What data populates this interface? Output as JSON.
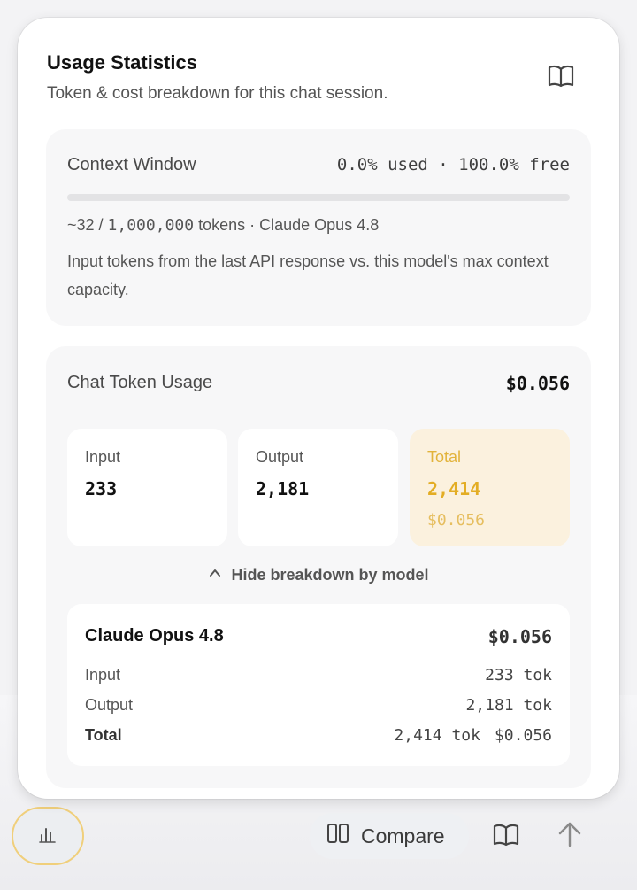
{
  "panel": {
    "title": "Usage Statistics",
    "subtitle": "Token & cost breakdown for this chat session.",
    "docs_icon": "book-icon"
  },
  "context_window": {
    "label": "Context Window",
    "stats": "0.0% used · 100.0% free",
    "used_fraction": 0.0,
    "tokens_prefix": "~32 / ",
    "tokens_max": "1,000,000",
    "tokens_suffix": " tokens · Claude Opus 4.8",
    "description": "Input tokens from the last API response vs. this model's max context capacity."
  },
  "chat_usage": {
    "label": "Chat Token Usage",
    "total_cost": "$0.056",
    "input": {
      "label": "Input",
      "value": "233"
    },
    "output": {
      "label": "Output",
      "value": "2,181"
    },
    "total": {
      "label": "Total",
      "value": "2,414",
      "cost": "$0.056"
    },
    "toggle_label": "Hide breakdown by model",
    "toggle_icon": "chevron-up-icon",
    "models": [
      {
        "name": "Claude Opus 4.8",
        "cost": "$0.056",
        "input_label": "Input",
        "input_value": "233 tok",
        "output_label": "Output",
        "output_value": "2,181 tok",
        "total_label": "Total",
        "total_tokens": "2,414 tok",
        "total_cost": "$0.056"
      }
    ]
  },
  "toolbar": {
    "stats_icon": "bar-chart-icon",
    "compare_label": "Compare",
    "compare_icon": "columns-icon",
    "book_icon": "book-icon",
    "send_icon": "arrow-up-icon"
  },
  "colors": {
    "accent": "#e3ad24",
    "accent_bg": "#fbf1de",
    "focus_ring": "#f0cf7b"
  }
}
